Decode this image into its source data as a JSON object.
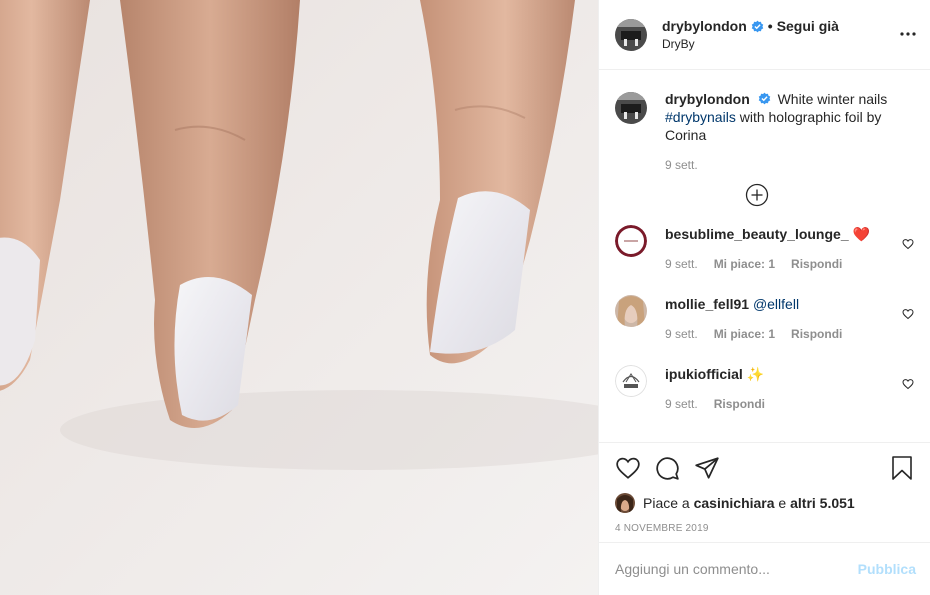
{
  "post": {
    "image_alt": "Hand with white holographic nails",
    "author": {
      "username": "drybylondon",
      "follow_separator": "•",
      "follow_label": "Segui già",
      "subtitle": "DryBy"
    },
    "caption": {
      "username": "drybylondon",
      "text_before": "White winter nails",
      "hashtag": "#drybynails",
      "text_after": "with holographic foil by Corina",
      "time": "9 sett."
    },
    "comments": [
      {
        "username": "besublime_beauty_lounge_",
        "text": "❤️",
        "time": "9 sett.",
        "likes": "Mi piace: 1",
        "reply": "Rispondi"
      },
      {
        "username": "mollie_fell91",
        "mention": "@ellfell",
        "time": "9 sett.",
        "likes": "Mi piace: 1",
        "reply": "Rispondi"
      },
      {
        "username": "ipukiofficial",
        "text": "✨",
        "time": "9 sett.",
        "reply": "Rispondi"
      }
    ],
    "likes": {
      "prefix": "Piace a",
      "user": "casinichiara",
      "joiner": "e",
      "others": "altri 5.051"
    },
    "date": "4 NOVEMBRE 2019",
    "add_comment": {
      "placeholder": "Aggiungi un commento...",
      "publish": "Pubblica"
    }
  },
  "colors": {
    "verified": "#3897f0",
    "link": "#00376b",
    "publish_disabled": "#b2dffc",
    "heart": "#ed4956"
  },
  "icons": [
    "more-icon",
    "verified-icon",
    "plus-circle-icon",
    "heart-icon",
    "comment-icon",
    "share-icon",
    "bookmark-icon"
  ]
}
